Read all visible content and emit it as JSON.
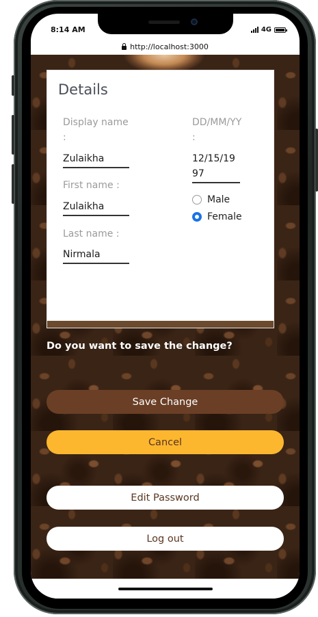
{
  "status_bar": {
    "time": "8:14 AM",
    "network": "4G"
  },
  "browser": {
    "url": "http://localhost:3000"
  },
  "details": {
    "title": "Details",
    "display_name_label_line1": "Display name",
    "display_name_label_line2": ":",
    "display_name_value": "Zulaikha",
    "first_name_label": "First name :",
    "first_name_value": "Zulaikha",
    "last_name_label": "Last name :",
    "last_name_value": "Nirmala",
    "dob_label_line1": "DD/MM/YY",
    "dob_label_line2": ":",
    "dob_value_line1": "12/15/19",
    "dob_value_line2": "97",
    "gender_options": [
      {
        "label": "Male",
        "selected": false
      },
      {
        "label": "Female",
        "selected": true
      }
    ]
  },
  "prompt": "Do you want to save the change?",
  "buttons": {
    "save": "Save Change",
    "cancel": "Cancel",
    "edit_password": "Edit Password",
    "logout": "Log out"
  },
  "colors": {
    "save_button": "#6a3f26",
    "cancel_button": "#fdb72f",
    "radio_selected": "#1a73e8"
  }
}
